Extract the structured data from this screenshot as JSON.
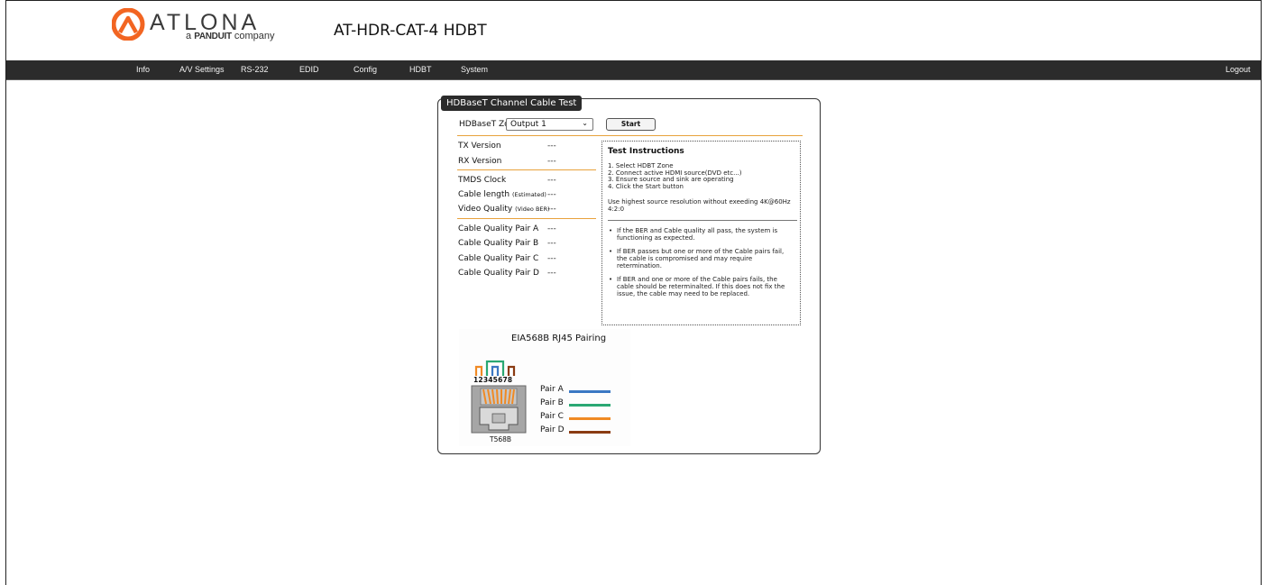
{
  "header": {
    "logo_word": "ATLONA",
    "logo_tag_brand": "PANDUIT",
    "logo_tag_prefix": "a",
    "logo_tag_suffix": "company",
    "product_title": "AT-HDR-CAT-4  HDBT"
  },
  "nav": {
    "items": [
      "Info",
      "A/V Settings",
      "RS-232",
      "EDID",
      "Config",
      "HDBT",
      "System"
    ],
    "logout": "Logout"
  },
  "panel": {
    "title": "HDBaseT Channel Cable Test",
    "zone_label": "HDBaseT Zone",
    "zone_value": "Output 1",
    "start_label": "Start",
    "tx_version": {
      "label": "TX Version",
      "value": "---"
    },
    "rx_version": {
      "label": "RX Version",
      "value": "---"
    },
    "tmds_clock": {
      "label": "TMDS Clock",
      "value": "---"
    },
    "cable_length": {
      "label": "Cable length",
      "note": "(Estimated)",
      "value": "---"
    },
    "video_quality": {
      "label": "Video Quality",
      "note": "(Video BER)",
      "value": "---"
    },
    "pairs": [
      {
        "label": "Cable Quality Pair A",
        "value": "---"
      },
      {
        "label": "Cable Quality Pair B",
        "value": "---"
      },
      {
        "label": "Cable Quality Pair C",
        "value": "---"
      },
      {
        "label": "Cable Quality Pair D",
        "value": "---"
      }
    ]
  },
  "instructions": {
    "title": "Test Instructions",
    "steps": [
      "1. Select HDBT Zone",
      "2. Connect active HDMI source(DVD etc...)",
      "3. Ensure source and sink are operating",
      "4. Click the Start button"
    ],
    "note": "Use highest source resolution without exeeding 4K@60Hz 4:2:0",
    "bullets": [
      "If the BER and Cable quality all pass, the system is functioning as expected.",
      "If BER passes but one or more of the Cable pairs fail, the cable is compromised and may require retermination.",
      "If BER and one or more of the Cable pairs fails, the cable should be reterminalted. If this does not fix the issue, the cable may need to be replaced."
    ]
  },
  "diagram": {
    "title": "EIA568B RJ45 Pairing",
    "pin_numbers": "12345678",
    "standard": "T568B",
    "pairs": [
      {
        "label": "Pair A",
        "color": "#3b78c3"
      },
      {
        "label": "Pair B",
        "color": "#2aa873"
      },
      {
        "label": "Pair C",
        "color": "#f08a24"
      },
      {
        "label": "Pair D",
        "color": "#8a3b12"
      }
    ]
  },
  "colors": {
    "nav_bg": "#2b2b2b",
    "accent_orange": "#e8a23c",
    "logo_orange": "#f26522"
  }
}
